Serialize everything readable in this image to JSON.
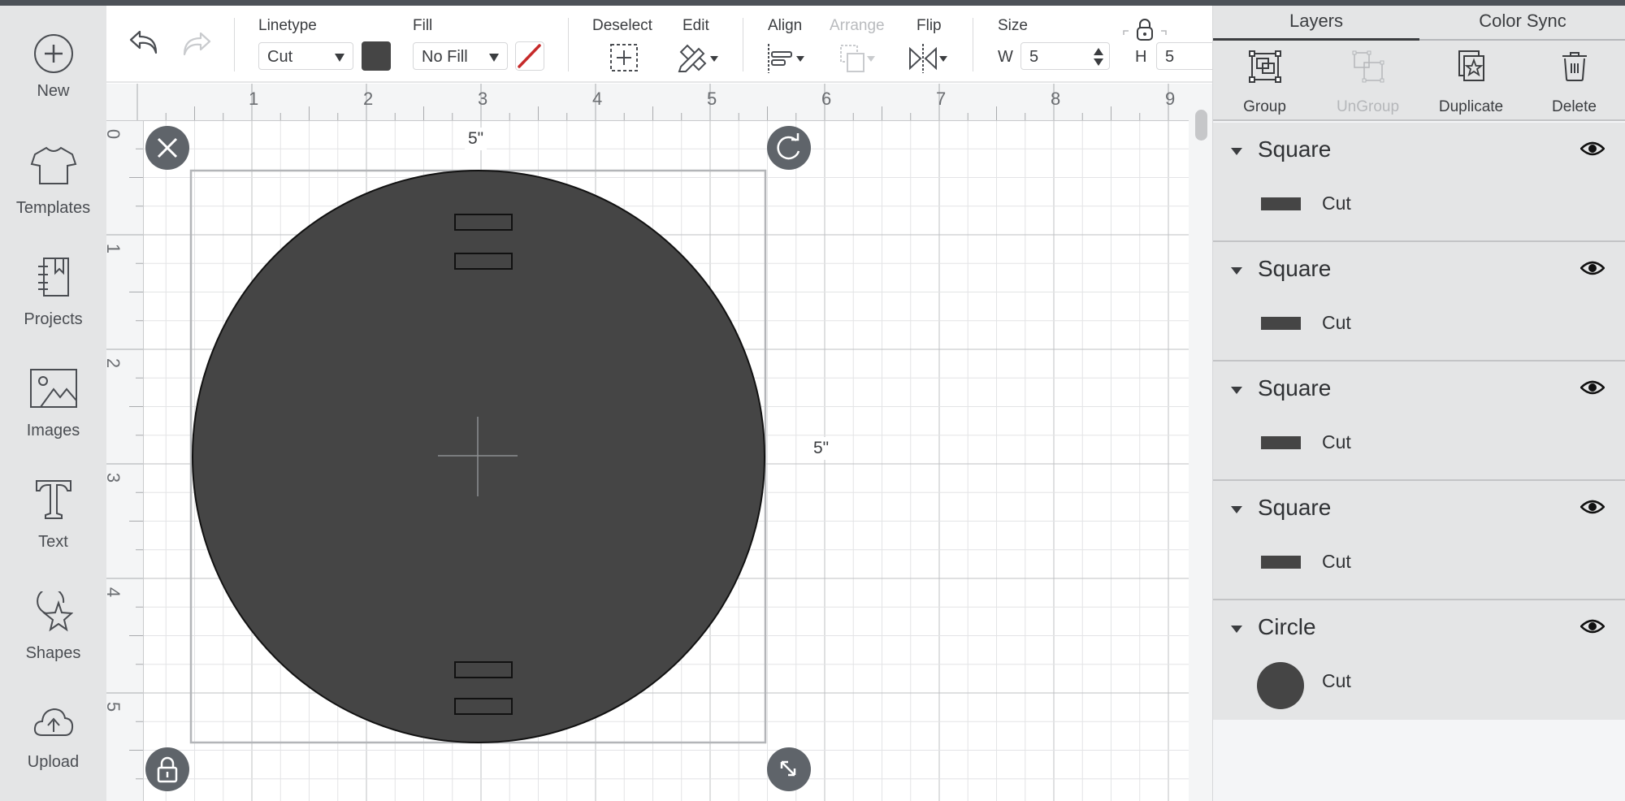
{
  "sidebar": {
    "items": [
      {
        "label": "New",
        "icon": "plus-circle-icon"
      },
      {
        "label": "Templates",
        "icon": "tshirt-icon"
      },
      {
        "label": "Projects",
        "icon": "notebook-icon"
      },
      {
        "label": "Images",
        "icon": "image-icon"
      },
      {
        "label": "Text",
        "icon": "text-t-icon"
      },
      {
        "label": "Shapes",
        "icon": "shapes-icon"
      },
      {
        "label": "Upload",
        "icon": "cloud-upload-icon"
      }
    ]
  },
  "toolbar": {
    "undo_icon": "undo-icon",
    "redo_icon": "redo-icon",
    "linetype": {
      "label": "Linetype",
      "value": "Cut",
      "color": "#454545"
    },
    "fill": {
      "label": "Fill",
      "value": "No Fill",
      "swatch": "no-fill-slash"
    },
    "deselect": {
      "label": "Deselect"
    },
    "edit": {
      "label": "Edit"
    },
    "align": {
      "label": "Align"
    },
    "arrange": {
      "label": "Arrange",
      "disabled": true
    },
    "flip": {
      "label": "Flip"
    },
    "size": {
      "label": "Size",
      "w_label": "W",
      "w_value": "5",
      "h_label": "H",
      "h_value": "5",
      "locked": true
    }
  },
  "rulers": {
    "top": [
      "1",
      "2",
      "3",
      "4",
      "5",
      "6",
      "7",
      "8",
      "9"
    ],
    "left": [
      "0",
      "1",
      "2",
      "3",
      "4",
      "5"
    ]
  },
  "canvas": {
    "selection": {
      "width_label": "5\"",
      "height_label": "5\"",
      "shape_fill": "#454545"
    },
    "handles": {
      "delete": "close-icon",
      "rotate": "rotate-icon",
      "lock": "lock-icon",
      "resize": "resize-icon"
    }
  },
  "panel": {
    "tabs": [
      {
        "label": "Layers",
        "active": true
      },
      {
        "label": "Color Sync",
        "active": false
      }
    ],
    "actions": [
      {
        "label": "Group",
        "disabled": false
      },
      {
        "label": "UnGroup",
        "disabled": true
      },
      {
        "label": "Duplicate",
        "disabled": false
      },
      {
        "label": "Delete",
        "disabled": false
      }
    ],
    "layers": [
      {
        "name": "Square",
        "type": "Cut",
        "shape": "rect"
      },
      {
        "name": "Square",
        "type": "Cut",
        "shape": "rect"
      },
      {
        "name": "Square",
        "type": "Cut",
        "shape": "rect"
      },
      {
        "name": "Square",
        "type": "Cut",
        "shape": "rect"
      },
      {
        "name": "Circle",
        "type": "Cut",
        "shape": "circle"
      }
    ]
  }
}
